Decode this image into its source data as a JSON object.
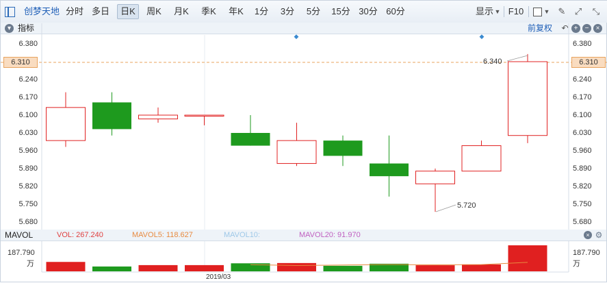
{
  "toolbar": {
    "stock_name": "创梦天地",
    "periods": [
      "分时",
      "多日",
      "日K",
      "周K",
      "月K",
      "季K",
      "年K",
      "1分",
      "3分",
      "5分",
      "15分",
      "30分",
      "60分"
    ],
    "active_period": "日K",
    "display_label": "显示",
    "f10_label": "F10",
    "draw_icon": "pencil-icon",
    "fullscreen_icon": "expand-icon",
    "window_icon": "restore-icon"
  },
  "indicator_bar": {
    "label": "指标",
    "adjust_label": "前复权",
    "icons": [
      "back-icon",
      "plus-icon",
      "minus-icon",
      "close-icon"
    ]
  },
  "price_axis": {
    "ticks": [
      "6.380",
      "6.310",
      "6.240",
      "6.170",
      "6.100",
      "6.030",
      "5.960",
      "5.890",
      "5.820",
      "5.750",
      "5.680"
    ],
    "current_price": "6.310",
    "current_price_color": "#e8a35e"
  },
  "annotations": {
    "high_label": "6.340",
    "low_label": "5.720"
  },
  "volume_bar": {
    "label": "MAVOL",
    "vol": "VOL: 267.240",
    "mavol5": "MAVOL5: 118.627",
    "mavol10": "MAVOL10:",
    "mavol20": "MAVOL20: 91.970",
    "axis_value": "187.790",
    "axis_unit": "万",
    "date_label": "2019/03"
  },
  "colors": {
    "up": "#e02020",
    "down": "#1e9a1e",
    "vol_label": "#e04040",
    "mavol5": "#e88a40",
    "mavol10": "#9ec8e8",
    "mavol20": "#c060c0",
    "accent": "#1f5fb7"
  },
  "chart_data": {
    "type": "candlestick",
    "candles": [
      {
        "open": 6.0,
        "close": 6.13,
        "high": 6.19,
        "low": 5.975,
        "dir": "up"
      },
      {
        "open": 6.15,
        "close": 6.045,
        "high": 6.19,
        "low": 6.02,
        "dir": "down"
      },
      {
        "open": 6.085,
        "close": 6.1,
        "high": 6.13,
        "low": 6.07,
        "dir": "up"
      },
      {
        "open": 6.1,
        "close": 6.1,
        "high": 6.1,
        "low": 6.06,
        "dir": "up"
      },
      {
        "open": 6.03,
        "close": 5.98,
        "high": 6.1,
        "low": 5.98,
        "dir": "down"
      },
      {
        "open": 5.91,
        "close": 6.0,
        "high": 6.07,
        "low": 5.9,
        "dir": "up"
      },
      {
        "open": 6.0,
        "close": 5.94,
        "high": 6.02,
        "low": 5.9,
        "dir": "down"
      },
      {
        "open": 5.91,
        "close": 5.86,
        "high": 6.02,
        "low": 5.78,
        "dir": "down"
      },
      {
        "open": 5.83,
        "close": 5.88,
        "high": 5.89,
        "low": 5.72,
        "dir": "up"
      },
      {
        "open": 5.88,
        "close": 5.98,
        "high": 6.0,
        "low": 5.88,
        "dir": "up"
      },
      {
        "open": 6.02,
        "close": 6.31,
        "high": 6.34,
        "low": 5.99,
        "dir": "up"
      }
    ],
    "volumes": [
      68,
      35,
      45,
      45,
      58,
      60,
      40,
      55,
      44,
      50,
      187.79
    ],
    "mavol5": [
      null,
      null,
      null,
      null,
      48,
      42,
      46,
      49,
      47,
      49,
      65
    ],
    "ylim": [
      5.68,
      6.38
    ]
  }
}
